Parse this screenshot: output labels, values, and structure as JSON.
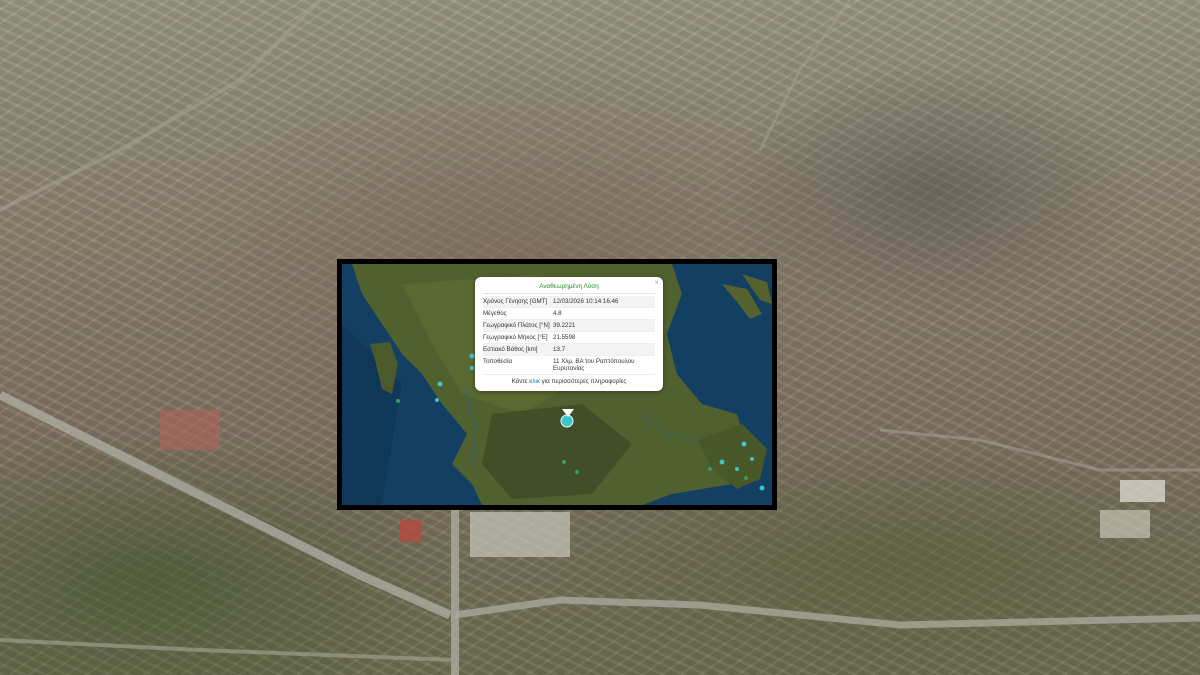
{
  "popup": {
    "title": "Αναθεωρημένη Λύση",
    "close_symbol": "×",
    "rows": [
      {
        "label": "Χρόνος Γένησης [GMT]",
        "value": "12/03/2026 10:14:16.46"
      },
      {
        "label": "Μέγεθος",
        "value": "4.8"
      },
      {
        "label": "Γεωγραφικό Πλάτος [°N]",
        "value": "39.2221"
      },
      {
        "label": "Γεωγραφικό Μήκος [°E]",
        "value": "21.5598"
      },
      {
        "label": "Εστιακό Βάθος [km]",
        "value": "13.7"
      },
      {
        "label": "Τοποθεσία",
        "value": "11 Χλμ. ΒΑ του Ραπτόπουλου Ευρυτανίας"
      }
    ],
    "footer_prefix": "Κάντε",
    "footer_link": "κλικ",
    "footer_suffix": "για περισσότερες πληροφορίες"
  },
  "colors": {
    "sea": "#123f62",
    "land": "#4f5a2c",
    "marker": "#3cc3cc",
    "marker_small": "#2f9f6a",
    "title_green": "#2a8a2a",
    "link_blue": "#1a6fd0"
  },
  "icons": [
    "close-icon",
    "earthquake-marker-icon"
  ]
}
